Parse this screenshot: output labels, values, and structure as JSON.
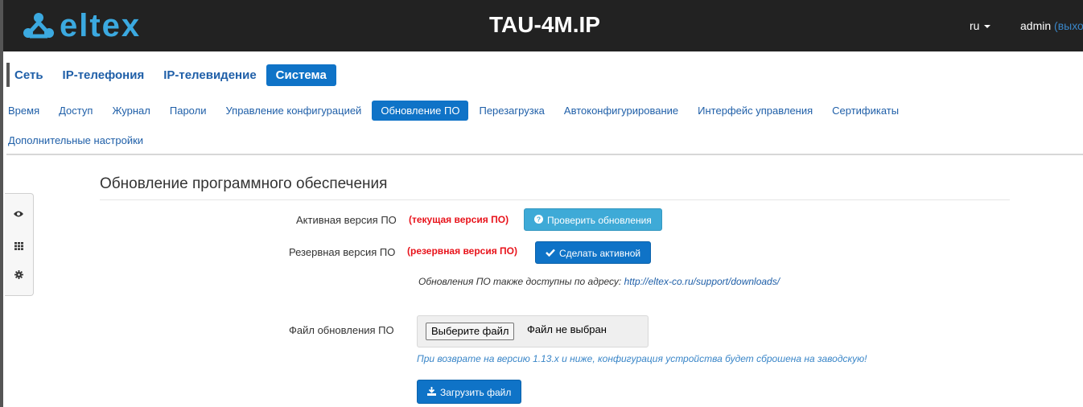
{
  "header": {
    "logo_text": "eltex",
    "device_name": "TAU-4M.IP",
    "language": "ru",
    "user": "admin",
    "logout": "(выход)"
  },
  "nav_primary": [
    {
      "label": "Сеть",
      "active": false
    },
    {
      "label": "IP-телефония",
      "active": false
    },
    {
      "label": "IP-телевидение",
      "active": false
    },
    {
      "label": "Система",
      "active": true
    }
  ],
  "nav_secondary": [
    {
      "label": "Время",
      "active": false
    },
    {
      "label": "Доступ",
      "active": false
    },
    {
      "label": "Журнал",
      "active": false
    },
    {
      "label": "Пароли",
      "active": false
    },
    {
      "label": "Управление конфигурацией",
      "active": false
    },
    {
      "label": "Обновление ПО",
      "active": true
    },
    {
      "label": "Перезагрузка",
      "active": false
    },
    {
      "label": "Автоконфигурирование",
      "active": false
    },
    {
      "label": "Интерфейс управления",
      "active": false
    },
    {
      "label": "Сертификаты",
      "active": false
    },
    {
      "label": "Дополнительные настройки",
      "active": false
    }
  ],
  "side_tools": [
    "eye-icon",
    "grid-icon",
    "gear-icon"
  ],
  "main": {
    "title": "Обновление программного обеспечения",
    "active_label": "Активная версия ПО",
    "active_value": "(текущая версия ПО)",
    "check_button": "Проверить обновления",
    "backup_label": "Резервная версия ПО",
    "backup_value": "(резервная версия ПО)",
    "make_active_button": "Сделать активной",
    "downloads_hint": "Обновления ПО также доступны по адресу:",
    "downloads_url": "http://eltex-co.ru/support/downloads/",
    "file_label": "Файл обновления ПО",
    "choose_file_button": "Выберите файл",
    "no_file": "Файл не выбран",
    "warning": "При возврате на версию 1.13.x и ниже, конфигурация устройства будет сброшена на заводскую!",
    "upload_button": "Загрузить файл"
  },
  "colors": {
    "topbar": "#222222",
    "accent": "#0f73c7",
    "info": "#3eaad7",
    "warning_text": "#e8131b",
    "logo": "#3ba9e0"
  }
}
